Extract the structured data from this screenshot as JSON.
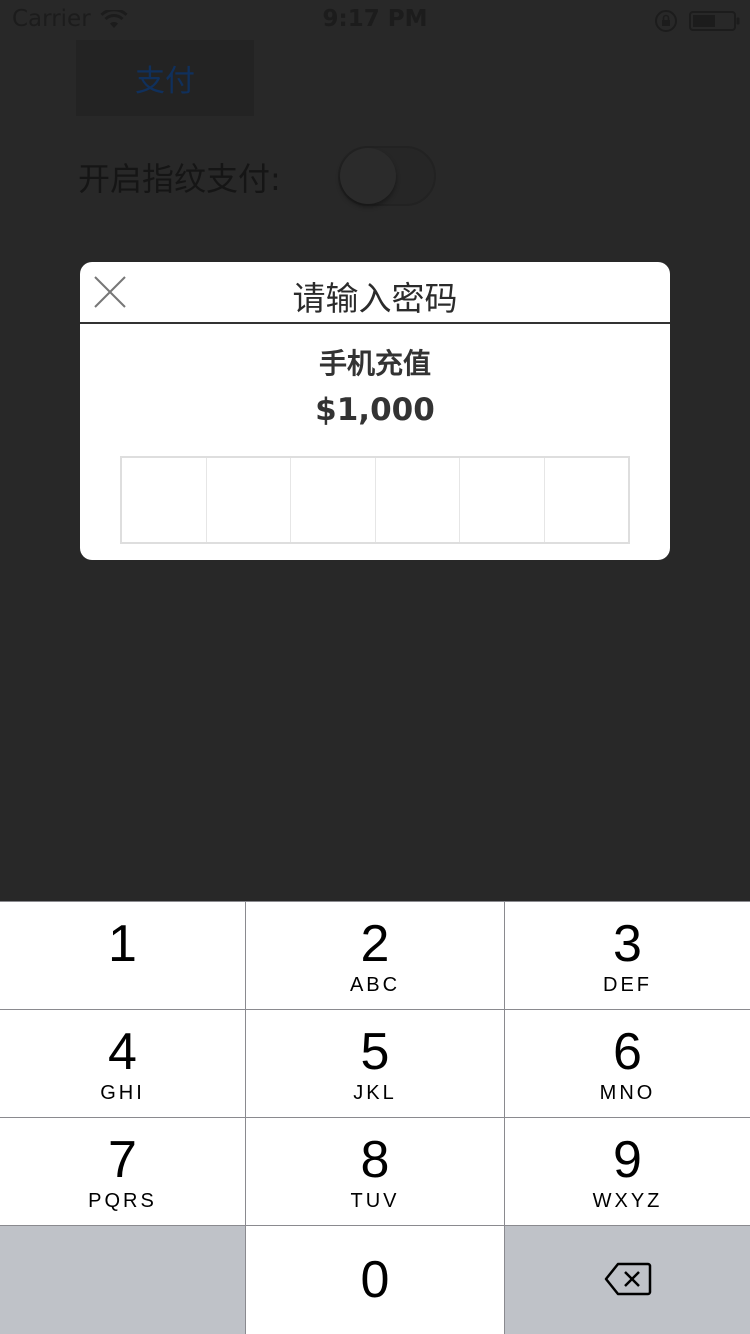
{
  "status_bar": {
    "carrier": "Carrier",
    "time": "9:17 PM",
    "icons": [
      "wifi-icon",
      "rotation-lock-icon",
      "battery-icon"
    ]
  },
  "page": {
    "pay_button": "支付",
    "fingerprint_label": "开启指纹支付:",
    "fingerprint_enabled": false
  },
  "dialog": {
    "title": "请输入密码",
    "item_name": "手机充值",
    "amount": "$1,000",
    "pin_length": 6,
    "pin_filled": 0,
    "close_icon": "close-icon"
  },
  "keypad": {
    "keys": [
      {
        "digit": "1",
        "letters": ""
      },
      {
        "digit": "2",
        "letters": "ABC"
      },
      {
        "digit": "3",
        "letters": "DEF"
      },
      {
        "digit": "4",
        "letters": "GHI"
      },
      {
        "digit": "5",
        "letters": "JKL"
      },
      {
        "digit": "6",
        "letters": "MNO"
      },
      {
        "digit": "7",
        "letters": "PQRS"
      },
      {
        "digit": "8",
        "letters": "TUV"
      },
      {
        "digit": "9",
        "letters": "WXYZ"
      }
    ],
    "zero": "0",
    "delete_icon": "backspace-icon",
    "colors": {
      "key": "#ffffff",
      "special_key": "#bfc2c8",
      "separator": "#8a8a8f"
    }
  }
}
